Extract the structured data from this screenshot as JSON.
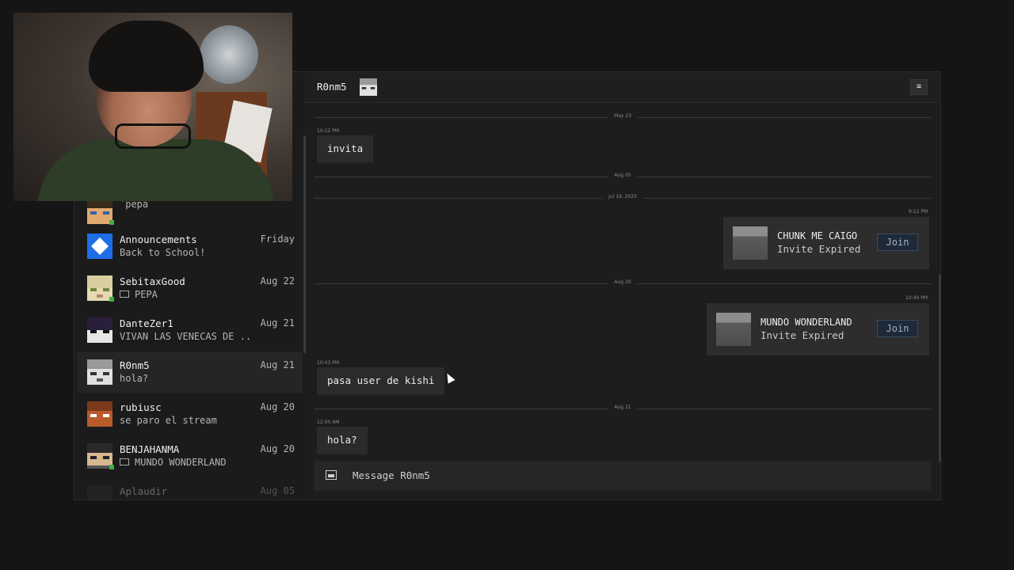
{
  "header": {
    "chat_name": "R0nm5",
    "menu_icon": "menu-icon",
    "menu_glyph": "≡"
  },
  "sidebar": {
    "conversations": [
      {
        "name": "",
        "preview": "´pepa",
        "date": "",
        "online": true
      },
      {
        "name": "Announcements",
        "preview": "Back to School!",
        "date": "Friday",
        "online": false
      },
      {
        "name": "SebitaxGood",
        "preview": "PEPA",
        "date": "Aug 22",
        "online": true,
        "preview_icon": "mail-icon"
      },
      {
        "name": "DanteZer1",
        "preview": "VIVAN LAS VENECAS DE ...",
        "date": "Aug 21",
        "online": false
      },
      {
        "name": "R0nm5",
        "preview": "hola?",
        "date": "Aug 21",
        "online": false,
        "selected": true
      },
      {
        "name": "rubiusc",
        "preview": "se paro el stream",
        "date": "Aug 20",
        "online": false
      },
      {
        "name": "BENJAHANMA",
        "preview": "MUNDO WONDERLAND",
        "date": "Aug 20",
        "online": true,
        "preview_icon": "mail-icon"
      },
      {
        "name": "Aplaudir",
        "preview": "",
        "date": "Aug 05",
        "online": false
      }
    ]
  },
  "chat": {
    "date_dividers": [
      "May 23",
      "Aug 05",
      "Jul 19, 2025",
      "Aug 20",
      "Aug 21"
    ],
    "messages": [
      {
        "time": "10:22 PM",
        "text": "invita",
        "side": "left"
      },
      {
        "time": "9:12 PM",
        "type": "invite",
        "title": "CHUNK ME CAIGO",
        "status": "Invite Expired",
        "button": "Join",
        "side": "right"
      },
      {
        "time": "10:40 PM",
        "type": "invite",
        "title": "MUNDO WONDERLAND",
        "status": "Invite Expired",
        "button": "Join",
        "side": "right"
      },
      {
        "time": "10:43 PM",
        "text": "pasa user de kishi",
        "side": "left"
      },
      {
        "time": "12:00 AM",
        "text": "hola?",
        "side": "left"
      }
    ]
  },
  "composer": {
    "placeholder": "Message R0nm5",
    "icon": "image-icon"
  },
  "colors": {
    "background": "#151515",
    "panel": "#1d1d1d",
    "bubble": "#2b2b2b",
    "online": "#3cb043",
    "join_button": "#1f2a38"
  }
}
